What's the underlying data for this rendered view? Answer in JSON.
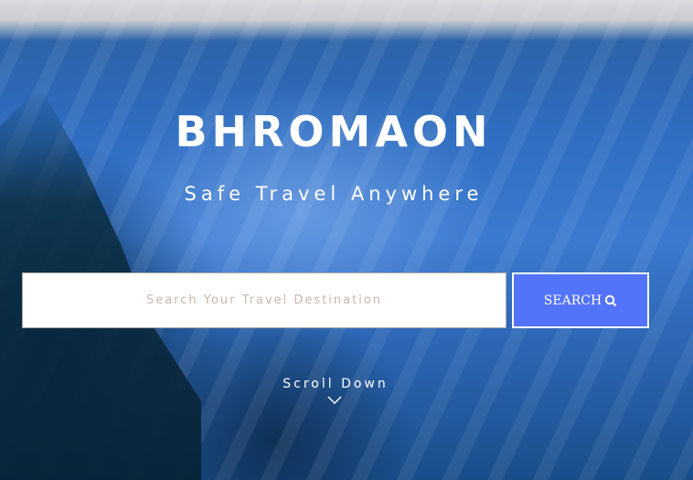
{
  "hero": {
    "title": "BHROMAON",
    "subtitle": "Safe Travel Anywhere"
  },
  "search": {
    "placeholder": "Search Your Travel Destination",
    "value": "",
    "button_label": "SEARCH",
    "button_color": "#5373fb"
  },
  "scroll": {
    "label": "Scroll Down"
  }
}
